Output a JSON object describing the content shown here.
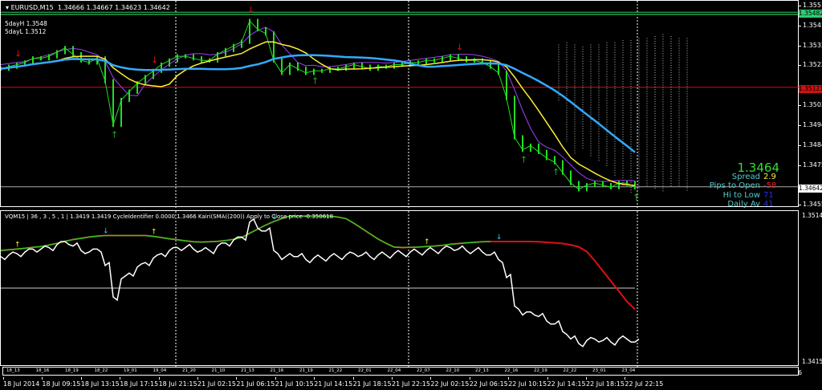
{
  "window": {
    "title": "EURUSD,M15",
    "ohlc": "1.34666 1.34667 1.34623 1.34642",
    "five_day_high": "5dayH 1.3548",
    "five_day_low": "5dayL 1.3512"
  },
  "price_axis": [
    "1.35510",
    "1.35415",
    "1.35320",
    "1.35225",
    "1.35035",
    "1.34940",
    "1.34845",
    "1.34750",
    "1.34550"
  ],
  "price_boxes": {
    "green": {
      "label": "1.35482",
      "price": 1.35482,
      "color": "#2ecc71"
    },
    "red": {
      "label": "1.35121",
      "price": 1.35121,
      "color": "#d01010"
    },
    "current": {
      "label": "1.34642",
      "price": 1.34642,
      "color": "#ffffff"
    }
  },
  "info_panel": {
    "price": "1.3464",
    "spread_label": "Spread",
    "spread_value": "2.9",
    "pips_label": "Pips to Open",
    "pips_value": "-58",
    "hilo_label": "Hi to Low",
    "hilo_value": "71",
    "daily_label": "Daily Av",
    "daily_value": "41"
  },
  "sub_window": {
    "title": "VQM15 | 36 , 3 , 5 , 1 | 1.3419 1.3419 CycleIdentifier 0.0000 1.3466 Kairi(SMA((200)) Apply to Close price -0.350618",
    "axis_top": "1.3514",
    "axis_bottom": "1.3415",
    "corner_label": "6"
  },
  "time_strip": [
    "18_13",
    "18_16",
    "18_19",
    "18_22",
    "19_01",
    "19_04",
    "21_20",
    "21_10",
    "21_13",
    "21_16",
    "21_19",
    "21_22",
    "22_01",
    "22_04",
    "22_07",
    "22_10",
    "22_13",
    "22_16",
    "22_19",
    "22_22",
    "23_01",
    "23_04"
  ],
  "date_axis": [
    "18 Jul 2014",
    "18 Jul 09:15",
    "18 Jul 13:15",
    "18 Jul 17:15",
    "18 Jul 21:15",
    "21 Jul 02:15",
    "21 Jul 06:15",
    "21 Jul 10:15",
    "21 Jul 14:15",
    "21 Jul 18:15",
    "21 Jul 22:15",
    "22 Jul 02:15",
    "22 Jul 06:15",
    "22 Jul 10:15",
    "22 Jul 14:15",
    "22 Jul 18:15",
    "22 Jul 22:15"
  ],
  "chart_data": {
    "type": "line",
    "symbol": "EURUSD",
    "timeframe": "M15",
    "ylim": [
      1.3455,
      1.3551
    ],
    "close": [
      1.3521,
      1.3522,
      1.3523,
      1.3524,
      1.3526,
      1.3526,
      1.3527,
      1.3529,
      1.3531,
      1.3528,
      1.3525,
      1.3524,
      1.3526,
      1.3515,
      1.3494,
      1.3506,
      1.351,
      1.3514,
      1.3517,
      1.352,
      1.3523,
      1.3525,
      1.3527,
      1.3527,
      1.3526,
      1.3525,
      1.3525,
      1.3528,
      1.353,
      1.3532,
      1.3534,
      1.3544,
      1.354,
      1.3538,
      1.3525,
      1.3519,
      1.3523,
      1.3521,
      1.3519,
      1.352,
      1.352,
      1.3521,
      1.3521,
      1.3522,
      1.3523,
      1.3522,
      1.3521,
      1.3522,
      1.3522,
      1.3523,
      1.3523,
      1.3524,
      1.3524,
      1.3525,
      1.3525,
      1.3526,
      1.3527,
      1.3526,
      1.3525,
      1.3525,
      1.3524,
      1.3522,
      1.3519,
      1.3507,
      1.3488,
      1.3482,
      1.3484,
      1.3481,
      1.3478,
      1.3476,
      1.3471,
      1.3466,
      1.3463,
      1.3465,
      1.3466,
      1.3465,
      1.3464,
      1.3466,
      1.3466,
      1.3464
    ],
    "colors": {
      "price": "#22dd22",
      "fast_ma": "#ffee33",
      "slow_ma": "#33aaff",
      "oscillator": "#ffffff",
      "signal_up": "#22aa22",
      "signal_down": "#dd1111"
    }
  }
}
